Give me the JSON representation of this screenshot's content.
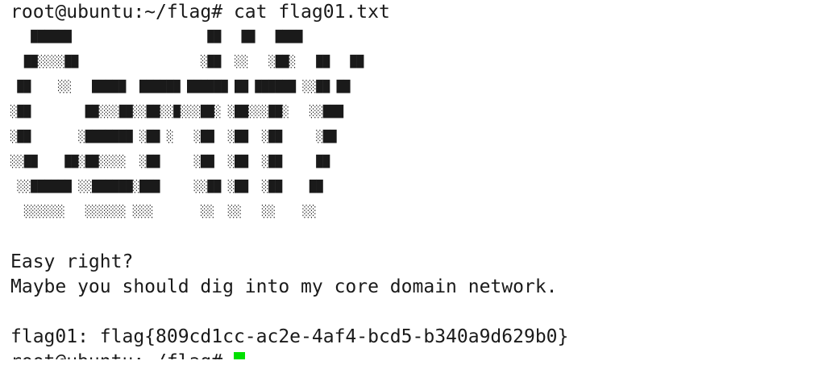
{
  "terminal": {
    "command_line": "root@ubuntu:~/flag# cat flag01.txt",
    "art_lines": [
      "   ██████                    ██   ██   ████",
      "  ██░░░░██                  ░██  ░░   ░██░   ██   ██",
      " ██    ░░   █████  ██████ ██████ ██ ██████ ░░██ ██",
      "░██        ██░░░██░░██░░█░░░██░ ░██░░░██░   ░░███",
      "░██       ░███████ ░██ ░   ░██  ░██  ░██     ░██",
      "░░██    ██░██░░░░  ░██     ░██  ░██  ░██     ██",
      " ░░██████ ░░██████░███     ░░██ ░██  ░██    ██",
      "  ░░░░░░   ░░░░░░ ░░░       ░░  ░░   ░░    ░░"
    ],
    "blank_1": "",
    "message_1": "Easy right?",
    "message_2": "Maybe you should dig into my core domain network.",
    "blank_2": "",
    "flag_line": "flag01: flag{809cd1cc-ac2e-4af4-bcd5-b340a9d629b0}",
    "prompt_partial": "root@ubuntu:~/flag# ",
    "cursor_color": "#00e000"
  }
}
